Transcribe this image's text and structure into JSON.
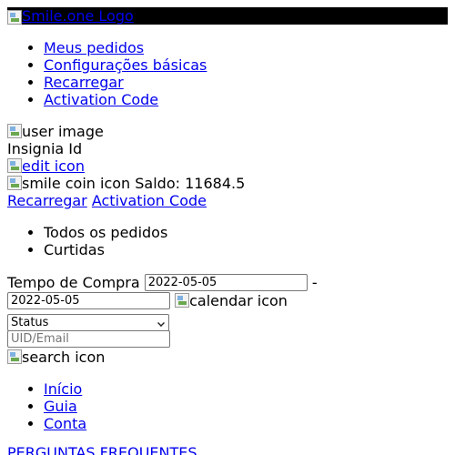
{
  "header": {
    "logo_alt": "Smile.one Logo"
  },
  "menu": {
    "items": [
      {
        "label": "Meus pedidos"
      },
      {
        "label": "Configurações básicas"
      },
      {
        "label": "Recarregar"
      },
      {
        "label": "Activation Code"
      }
    ]
  },
  "profile": {
    "user_image_alt": "user image",
    "insignia_label": "Insignia Id",
    "edit_icon_alt": "edit icon",
    "coin_icon_alt": "smile coin icon",
    "balance_text": "Saldo: 11684.5",
    "recharge_link": "Recarregar",
    "activation_link": "Activation Code"
  },
  "orders": {
    "tabs": [
      {
        "label": "Todos os pedidos"
      },
      {
        "label": "Curtidas"
      }
    ],
    "filter": {
      "purchase_time_label": "Tempo de Compra",
      "date_from": "2022-05-05",
      "separator": "-",
      "date_to": "2022-05-05",
      "calendar_icon_alt": "calendar icon",
      "status_selected": "Status",
      "search_placeholder": "UID/Email",
      "search_icon_alt": "search icon"
    }
  },
  "footer": {
    "nav": [
      {
        "label": "Início"
      },
      {
        "label": "Guia"
      },
      {
        "label": "Conta"
      }
    ],
    "faq_link": "PERGUNTAS FREQUENTES"
  }
}
